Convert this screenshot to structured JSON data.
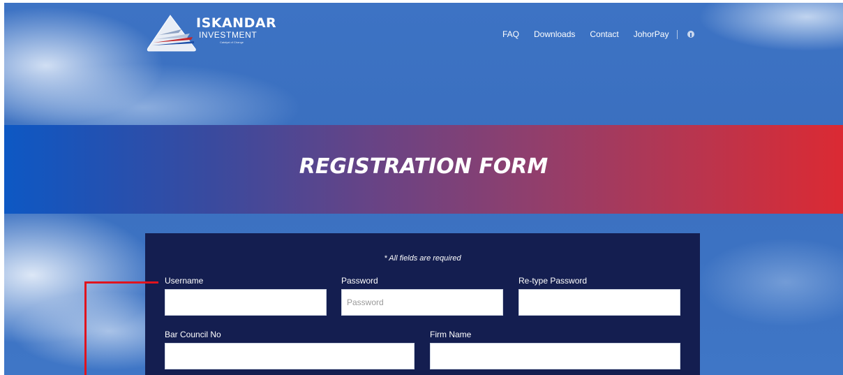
{
  "colors": {
    "brand_blue": "#0d58c4",
    "brand_red": "#db2a33",
    "panel_navy": "#141e50",
    "annotation_red": "#e0141e"
  },
  "logo": {
    "name": "ISKANDAR",
    "subtitle": "INVESTMENT",
    "tagline": "Catalyst of Change",
    "icon": "triangle-logo-icon"
  },
  "nav": {
    "items": [
      "FAQ",
      "Downloads",
      "Contact",
      "JohorPay"
    ],
    "social_icon": "facebook-icon"
  },
  "banner": {
    "title": "REGISTRATION FORM"
  },
  "form": {
    "required_note": "* All fields are required",
    "username": {
      "label": "Username",
      "value": "",
      "placeholder": ""
    },
    "password": {
      "label": "Password",
      "value": "",
      "placeholder": "Password"
    },
    "retype_password": {
      "label": "Re-type Password",
      "value": "",
      "placeholder": ""
    },
    "bar_council_no": {
      "label": "Bar Council No",
      "value": "",
      "placeholder": ""
    },
    "firm_name": {
      "label": "Firm Name",
      "value": "",
      "placeholder": ""
    }
  }
}
